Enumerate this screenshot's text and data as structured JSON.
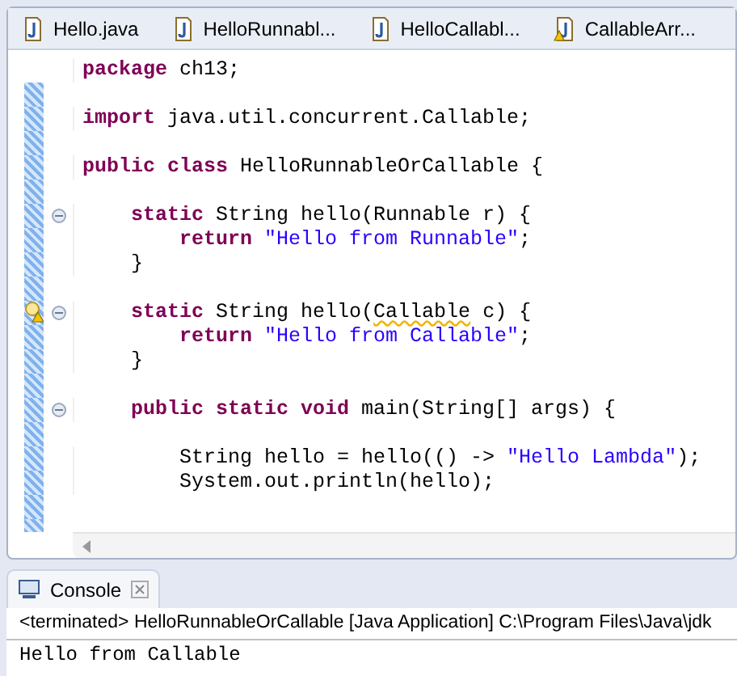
{
  "editor_tabs": [
    {
      "label": "Hello.java",
      "warning": false
    },
    {
      "label": "HelloRunnabl...",
      "warning": false
    },
    {
      "label": "HelloCallabl...",
      "warning": false
    },
    {
      "label": "CallableArr...",
      "warning": true
    }
  ],
  "code_lines": [
    {
      "kind": "code",
      "fold": false,
      "warning": false,
      "segments": [
        {
          "kind": "keyword",
          "text": "package"
        },
        {
          "kind": "plain",
          "text": " ch13;"
        }
      ]
    },
    {
      "kind": "blank"
    },
    {
      "kind": "code",
      "fold": false,
      "warning": false,
      "segments": [
        {
          "kind": "keyword",
          "text": "import"
        },
        {
          "kind": "plain",
          "text": " java.util.concurrent.Callable;"
        }
      ]
    },
    {
      "kind": "blank"
    },
    {
      "kind": "code",
      "fold": false,
      "warning": false,
      "segments": [
        {
          "kind": "keyword",
          "text": "public class"
        },
        {
          "kind": "plain",
          "text": " HelloRunnableOrCallable {"
        }
      ],
      "children": [
        {
          "kind": "blank"
        },
        {
          "kind": "code",
          "fold": true,
          "warning": false,
          "segments": [
            {
              "kind": "keyword",
              "text": "static"
            },
            {
              "kind": "plain",
              "text": " String hello(Runnable r) {"
            }
          ],
          "children": [
            {
              "kind": "code",
              "fold": false,
              "warning": false,
              "segments": [
                {
                  "kind": "keyword",
                  "text": "return"
                },
                {
                  "kind": "string",
                  "text": " \"Hello from Runnable\""
                },
                {
                  "kind": "plain",
                  "text": ";"
                }
              ]
            }
          ]
        },
        {
          "kind": "code",
          "fold": false,
          "warning": false,
          "segments": [
            {
              "kind": "plain",
              "text": "}"
            }
          ]
        },
        {
          "kind": "blank"
        },
        {
          "kind": "code",
          "fold": true,
          "warning": true,
          "segments": [
            {
              "kind": "keyword",
              "text": "static"
            },
            {
              "kind": "plain",
              "text": " String hello("
            },
            {
              "kind": "warned",
              "text": "Callable"
            },
            {
              "kind": "plain",
              "text": " c) {"
            }
          ],
          "children": [
            {
              "kind": "code",
              "fold": false,
              "warning": false,
              "segments": [
                {
                  "kind": "keyword",
                  "text": "return"
                },
                {
                  "kind": "string",
                  "text": " \"Hello from Callable\""
                },
                {
                  "kind": "plain",
                  "text": ";"
                }
              ]
            }
          ]
        },
        {
          "kind": "code",
          "fold": false,
          "warning": false,
          "segments": [
            {
              "kind": "plain",
              "text": "}"
            }
          ]
        },
        {
          "kind": "blank"
        },
        {
          "kind": "code",
          "fold": true,
          "warning": false,
          "segments": [
            {
              "kind": "keyword",
              "text": "public static void"
            },
            {
              "kind": "plain",
              "text": " main(String[] args) {"
            }
          ],
          "children": [
            {
              "kind": "blank"
            },
            {
              "kind": "code",
              "fold": false,
              "warning": false,
              "segments": [
                {
                  "kind": "plain",
                  "text": "String hello = hello(() -> "
                },
                {
                  "kind": "string",
                  "text": "\"Hello Lambda\""
                },
                {
                  "kind": "plain",
                  "text": ");"
                }
              ]
            },
            {
              "kind": "code",
              "fold": false,
              "warning": false,
              "segments": [
                {
                  "kind": "plain",
                  "text": "System.out.println(hello);"
                }
              ]
            },
            {
              "kind": "blank"
            }
          ]
        }
      ]
    }
  ],
  "console": {
    "tab_label": "Console",
    "status": "<terminated> HelloRunnableOrCallable [Java Application] C:\\Program Files\\Java\\jdk",
    "output": "Hello from Callable"
  }
}
